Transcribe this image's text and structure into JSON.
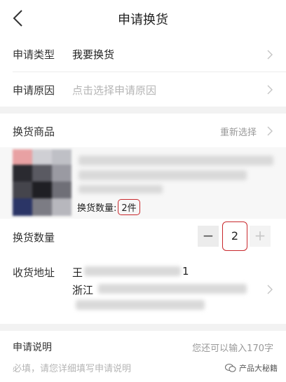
{
  "nav": {
    "title": "申请换货"
  },
  "apply_type": {
    "label": "申请类型",
    "value": "我要换货"
  },
  "apply_reason": {
    "label": "申请原因",
    "placeholder": "点击选择申请原因"
  },
  "goods": {
    "label": "换货商品",
    "reselect": "重新选择",
    "qty_label": "换货数量:",
    "qty_value": "2件"
  },
  "exchange_qty": {
    "label": "换货数量",
    "minus": "−",
    "value": "2",
    "plus": "+"
  },
  "address": {
    "label": "收货地址",
    "line1_prefix": "王",
    "line1_suffix": "1",
    "line2_prefix": "浙江"
  },
  "description": {
    "label": "申请说明",
    "counter": "您还可以输入170字",
    "placeholder": "必填，请您详细填写申请说明"
  },
  "watermark": {
    "text": "产品大秘籍"
  },
  "colors": {
    "accent": "#c8282c",
    "muted": "#999999",
    "placeholder": "#b5b5b5",
    "background_gap": "#f2f2f2"
  }
}
